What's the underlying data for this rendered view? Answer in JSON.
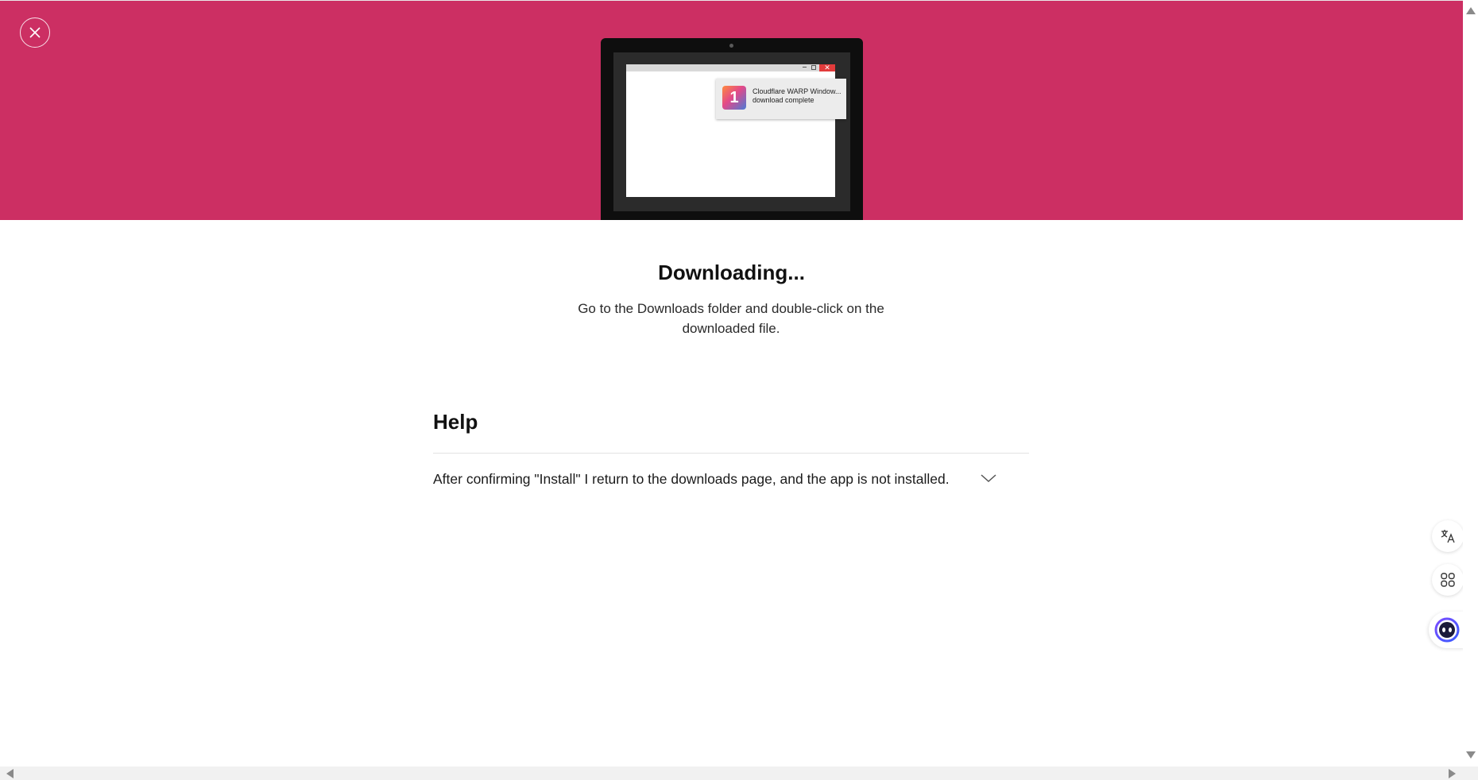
{
  "hero": {
    "background_color": "#cc2f63",
    "close_icon": "close-icon",
    "illustration": {
      "toast_title": "Cloudflare WARP Window...",
      "toast_subtitle": "download complete",
      "toast_app_glyph": "1",
      "window_close_glyph": "✕"
    }
  },
  "main": {
    "title": "Downloading...",
    "subtitle": "Go to the Downloads folder and double-click on the downloaded file."
  },
  "help": {
    "title": "Help",
    "items": [
      {
        "question": "After confirming \"Install\" I return to the downloads page, and the app is not installed.",
        "expanded": false,
        "icon": "chevron-down-icon"
      }
    ]
  },
  "side_tools": {
    "items": [
      {
        "icon": "translate-icon"
      },
      {
        "icon": "apps-grid-icon"
      },
      {
        "icon": "assistant-face-icon"
      }
    ]
  }
}
